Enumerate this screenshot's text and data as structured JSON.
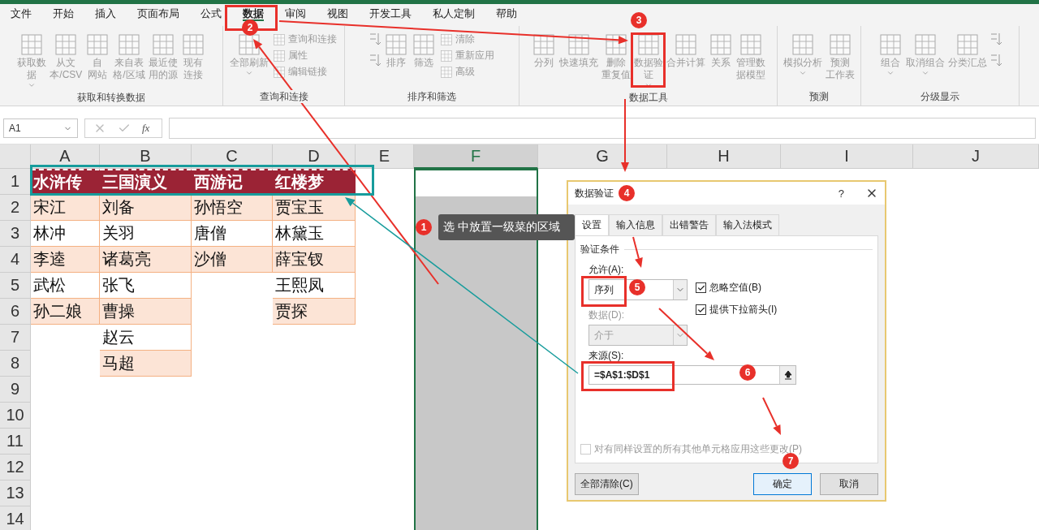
{
  "menu_tabs": [
    {
      "label": "文件",
      "selected": false
    },
    {
      "label": "开始",
      "selected": false
    },
    {
      "label": "插入",
      "selected": false
    },
    {
      "label": "页面布局",
      "selected": false
    },
    {
      "label": "公式",
      "selected": false
    },
    {
      "label": "数据",
      "selected": true
    },
    {
      "label": "审阅",
      "selected": false
    },
    {
      "label": "视图",
      "selected": false
    },
    {
      "label": "开发工具",
      "selected": false
    },
    {
      "label": "私人定制",
      "selected": false
    },
    {
      "label": "帮助",
      "selected": false
    }
  ],
  "ribbon": {
    "groups": [
      {
        "label": "获取和转换数据",
        "items": [
          {
            "kind": "large",
            "lines": [
              "获取数",
              "据"
            ],
            "dropdown": true
          },
          {
            "kind": "large",
            "lines": [
              "从文",
              "本/CSV"
            ],
            "dropdown": false
          },
          {
            "kind": "large",
            "lines": [
              "自",
              "网站"
            ],
            "dropdown": false
          },
          {
            "kind": "large",
            "lines": [
              "来自表",
              "格/区域"
            ],
            "dropdown": false
          },
          {
            "kind": "large",
            "lines": [
              "最近使",
              "用的源"
            ],
            "dropdown": false
          },
          {
            "kind": "large",
            "lines": [
              "现有",
              "连接"
            ],
            "dropdown": false
          }
        ]
      },
      {
        "label": "查询和连接",
        "items": [
          {
            "kind": "large",
            "lines": [
              "全部刷新"
            ],
            "dropdown": true
          },
          {
            "kind": "small",
            "lines": [
              "查询和连接",
              "属性",
              "编辑链接"
            ]
          }
        ]
      },
      {
        "label": "排序和筛选",
        "items": [
          {
            "kind": "sort"
          },
          {
            "kind": "large",
            "lines": [
              "排序"
            ],
            "dropdown": false
          },
          {
            "kind": "large",
            "lines": [
              "筛选"
            ],
            "dropdown": false
          },
          {
            "kind": "small",
            "lines": [
              "清除",
              "重新应用",
              "高级"
            ]
          }
        ]
      },
      {
        "label": "数据工具",
        "items": [
          {
            "kind": "large",
            "lines": [
              "分列"
            ],
            "dropdown": false
          },
          {
            "kind": "large",
            "lines": [
              "快速填充"
            ],
            "dropdown": false
          },
          {
            "kind": "large",
            "lines": [
              "删除",
              "重复值"
            ],
            "dropdown": false
          },
          {
            "kind": "large",
            "lines": [
              "数据验",
              "证"
            ],
            "dropdown": true
          },
          {
            "kind": "large",
            "lines": [
              "合并计算"
            ],
            "dropdown": false
          },
          {
            "kind": "large",
            "lines": [
              "关系"
            ],
            "dropdown": false
          },
          {
            "kind": "large",
            "lines": [
              "管理数",
              "据模型"
            ],
            "dropdown": false
          }
        ]
      },
      {
        "label": "预测",
        "items": [
          {
            "kind": "large",
            "lines": [
              "模拟分析"
            ],
            "dropdown": true
          },
          {
            "kind": "large",
            "lines": [
              "预测",
              "工作表"
            ],
            "dropdown": false
          }
        ]
      },
      {
        "label": "分级显示",
        "items": [
          {
            "kind": "large",
            "lines": [
              "组合"
            ],
            "dropdown": true
          },
          {
            "kind": "large",
            "lines": [
              "取消组合"
            ],
            "dropdown": true
          },
          {
            "kind": "large",
            "lines": [
              "分类汇总"
            ],
            "dropdown": false
          },
          {
            "kind": "sort"
          }
        ]
      }
    ]
  },
  "formula_bar": {
    "name_box": "A1",
    "function_label": "fx"
  },
  "sheet": {
    "columns": [
      {
        "label": "A",
        "selected": false
      },
      {
        "label": "B",
        "selected": false
      },
      {
        "label": "C",
        "selected": false
      },
      {
        "label": "D",
        "selected": false
      },
      {
        "label": "E",
        "selected": false
      },
      {
        "label": "F",
        "selected": true
      },
      {
        "label": "G",
        "selected": false
      },
      {
        "label": "H",
        "selected": false
      },
      {
        "label": "I",
        "selected": false
      },
      {
        "label": "J",
        "selected": false
      }
    ],
    "header_row": {
      "label": "1",
      "cells": [
        "水浒传",
        "三国演义",
        "西游记",
        "红楼梦"
      ]
    },
    "rows": [
      {
        "label": "2",
        "cells": [
          "宋江",
          "刘备",
          "孙悟空",
          "贾宝玉"
        ]
      },
      {
        "label": "3",
        "cells": [
          "林冲",
          "关羽",
          "唐僧",
          "林黛玉"
        ]
      },
      {
        "label": "4",
        "cells": [
          "李逵",
          "诸葛亮",
          "沙僧",
          "薛宝钗"
        ]
      },
      {
        "label": "5",
        "cells": [
          "武松",
          "张飞",
          null,
          "王熙凤"
        ]
      },
      {
        "label": "6",
        "cells": [
          "孙二娘",
          "曹操",
          null,
          "贾探"
        ]
      },
      {
        "label": "7",
        "cells": [
          null,
          "赵云"
        ]
      },
      {
        "label": "8",
        "cells": [
          null,
          "马超"
        ]
      },
      {
        "label": "9",
        "cells": []
      },
      {
        "label": "10",
        "cells": []
      },
      {
        "label": "11",
        "cells": []
      },
      {
        "label": "12",
        "cells": []
      },
      {
        "label": "13",
        "cells": []
      },
      {
        "label": "14",
        "cells": []
      }
    ]
  },
  "callout": {
    "badge": "1",
    "text": "选 中放置一级菜的区域"
  },
  "step_badges": [
    "2",
    "3",
    "4",
    "5",
    "6",
    "7"
  ],
  "dialog": {
    "title": "数据验证",
    "help": "?",
    "tabs": [
      {
        "label": "设置",
        "selected": true
      },
      {
        "label": "输入信息",
        "selected": false
      },
      {
        "label": "出错警告",
        "selected": false
      },
      {
        "label": "输入法模式",
        "selected": false
      }
    ],
    "section": "验证条件",
    "allow": {
      "label": "允许(A):",
      "value": "序列"
    },
    "options": [
      {
        "label": "忽略空值(B)",
        "checked": true
      },
      {
        "label": "提供下拉箭头(I)",
        "checked": true
      }
    ],
    "data": {
      "label": "数据(D):",
      "value": "介于",
      "disabled": true
    },
    "source": {
      "label": "来源(S):",
      "value": "=$A$1:$D$1"
    },
    "apply_all": {
      "label": "对有同样设置的所有其他单元格应用这些更改(P)",
      "checked": false,
      "disabled": true
    },
    "buttons": [
      {
        "label": "全部清除(C)",
        "default": false
      },
      {
        "label": "确定",
        "default": true
      },
      {
        "label": "取消",
        "default": false
      }
    ]
  }
}
